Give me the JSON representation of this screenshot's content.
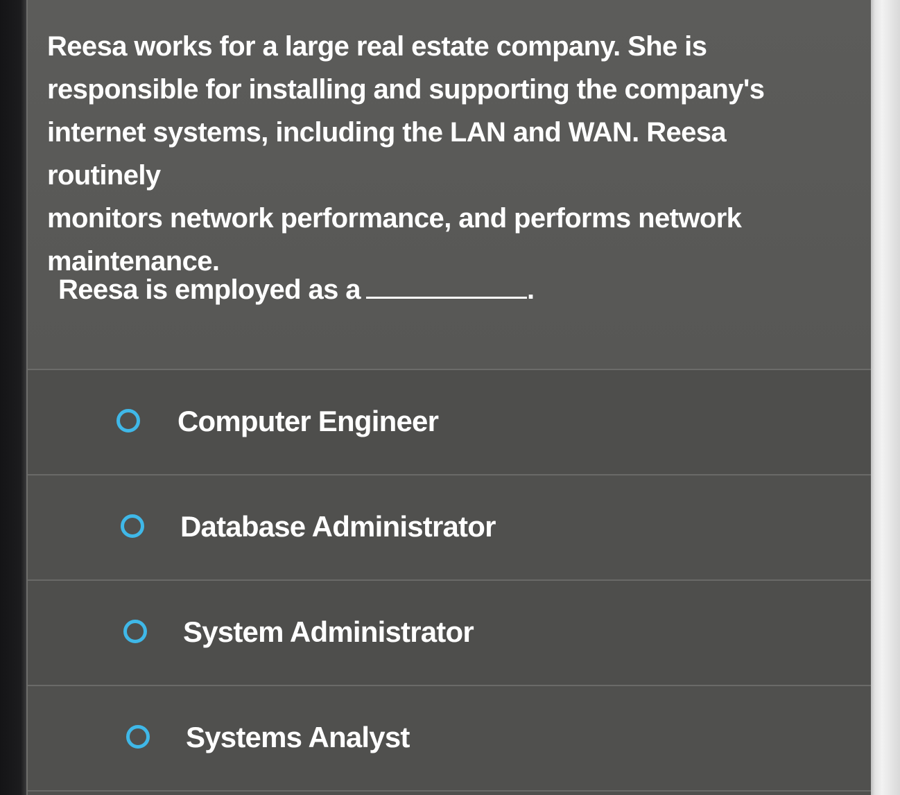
{
  "question": {
    "text_lines": [
      "Reesa works for a large real estate company. She is",
      "responsible for installing and supporting the company's",
      "internet systems, including the LAN and WAN. Reesa routinely",
      "monitors network performance, and performs network",
      "maintenance."
    ],
    "prompt": "Reesa is employed as a",
    "prompt_end": "."
  },
  "options": [
    {
      "label": "Computer Engineer",
      "selected": false
    },
    {
      "label": "Database Administrator",
      "selected": false
    },
    {
      "label": "System Administrator",
      "selected": false
    },
    {
      "label": "Systems Analyst",
      "selected": false
    }
  ],
  "colors": {
    "radio_accent": "#3fb8e8",
    "panel_background": "#575755",
    "text": "#ffffff"
  }
}
